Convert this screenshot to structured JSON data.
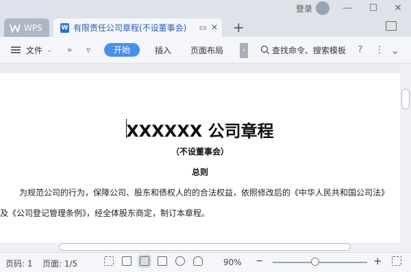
{
  "titlebar": {
    "wps_tab": "WPS",
    "doc_tab": "有限责任公司章程(不设董事会)",
    "new_tab": "+",
    "login": "登录"
  },
  "toolbar": {
    "file": "文件",
    "more": "»",
    "dropdown": "▿",
    "start": "开始",
    "insert": "插入",
    "page_layout": "页面布局",
    "scroll": "›",
    "search": "查找命令、搜索模板",
    "help": "?",
    "menu": "⋮",
    "collapse": "⌄"
  },
  "document": {
    "title": "XXXXXX 公司章程",
    "subtitle": "（不设董事会）",
    "section": "总则",
    "para1": "为规范公司的行为，保障公司、股东和债权人的的合法权益，依照修改后的《中华人民共和国公司法》",
    "para2": "及《公司登记管理条例》，经全体股东商定，制订本章程。"
  },
  "status": {
    "page_code": "页码: 1",
    "page_count": "页面: 1/5",
    "zoom": "90%",
    "zoom_level": 0.45
  }
}
